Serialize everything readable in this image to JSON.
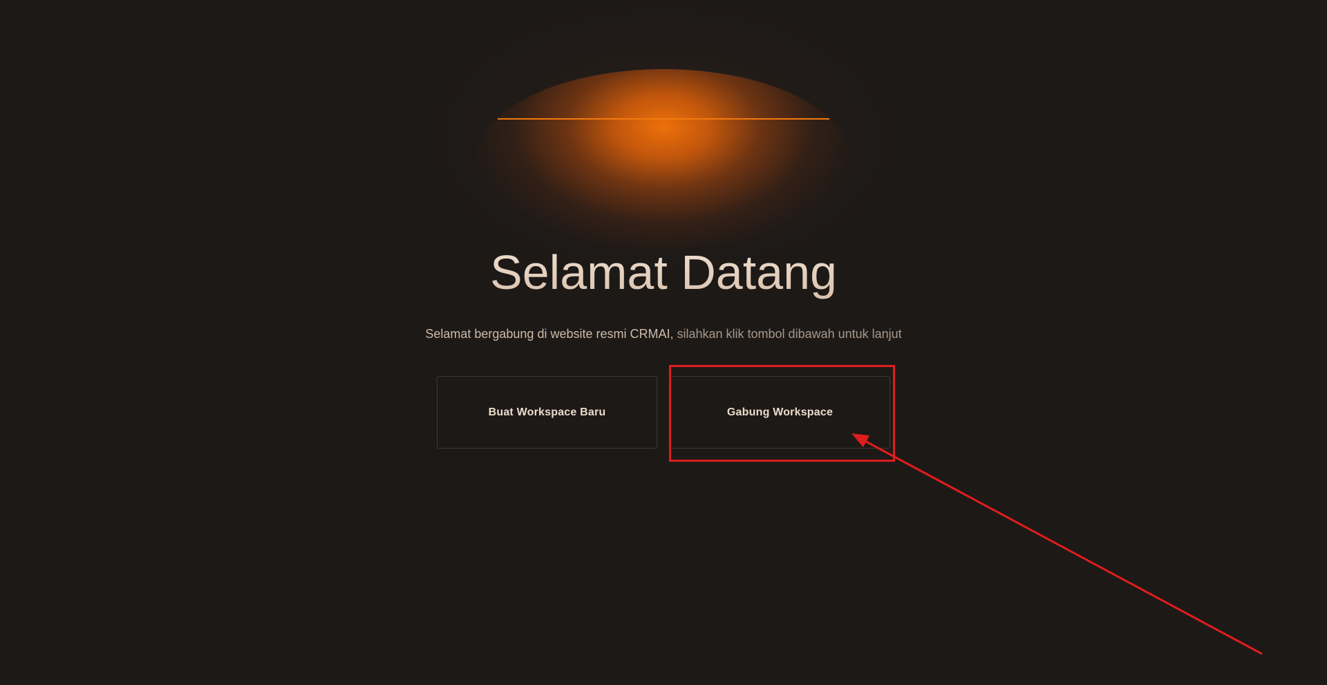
{
  "welcome": {
    "title": "Selamat Datang",
    "subtitle_main": "Selamat bergabung di website resmi CRMAI,",
    "subtitle_rest": " silahkan klik tombol dibawah untuk lanjut"
  },
  "actions": {
    "create_workspace_label": "Buat Workspace Baru",
    "join_workspace_label": "Gabung Workspace"
  },
  "colors": {
    "background": "#1d1917",
    "accent_orange": "#f07a10",
    "title_text": "#e6d4c2",
    "button_border": "#3e3935",
    "annotation_red": "#e01d1d"
  }
}
